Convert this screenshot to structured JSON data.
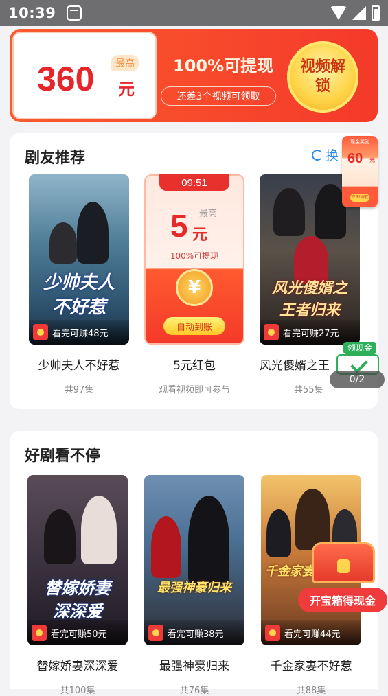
{
  "status_bar": {
    "time": "10:39"
  },
  "banner": {
    "amount": "360",
    "unit": "元",
    "max_tag": "最高",
    "title": "100%可提现",
    "subtitle": "还差3个视频可领取",
    "button_label": "视频解锁"
  },
  "section_recommend": {
    "title": "剧友推荐",
    "refresh_label": "换",
    "items": [
      {
        "poster_text": "少帅夫人\n不好惹",
        "earn": "看完可赚48元",
        "title": "少帅夫人不好惹",
        "count": "共97集"
      },
      {
        "title": "5元红包",
        "count": "观看视频即可参与"
      },
      {
        "poster_text": "风光傻婿之\n王者归来",
        "earn": "看完可赚27元",
        "title": "风光傻婿之王",
        "count": "共55集"
      }
    ],
    "red_packet": {
      "timer": "09:51",
      "max_tag": "最高",
      "amount": "5",
      "unit": "元",
      "note": "100%可提现",
      "coin": "¥",
      "auto_label": "自动到账"
    }
  },
  "section_binge": {
    "title": "好剧看不停",
    "items": [
      {
        "poster_text": "替嫁娇妻\n深深爱",
        "earn": "看完可赚50元",
        "title": "替嫁娇妻深深爱",
        "count": "共100集"
      },
      {
        "poster_text": "最强神豪归来",
        "earn": "看完可赚38元",
        "title": "最强神豪归来",
        "count": "共76集"
      },
      {
        "poster_text": "千金家妻",
        "earn": "看完可赚44元",
        "title": "千金家妻不好惹",
        "count": "共88集"
      }
    ]
  },
  "float_reward": {
    "top": "现金奖励",
    "amount": "60",
    "unit": "元",
    "button": "立即领取"
  },
  "float_gold": {
    "tag": "领现金",
    "progress": "0/2"
  },
  "float_chest": {
    "label": "开宝箱得现金"
  }
}
